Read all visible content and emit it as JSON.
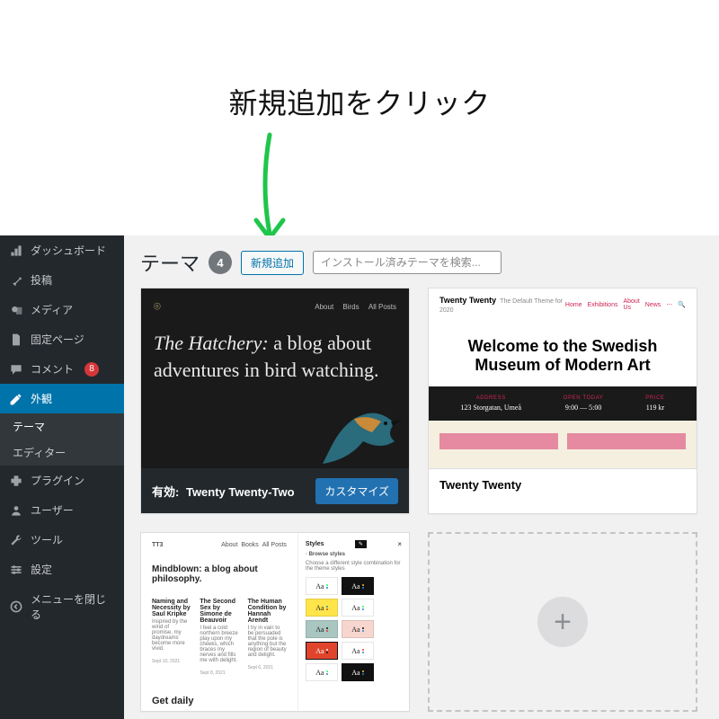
{
  "annotation": {
    "text": "新規追加をクリック"
  },
  "sidebar": {
    "items": [
      {
        "label": "ダッシュボード",
        "icon": "dashboard-icon"
      },
      {
        "label": "投稿",
        "icon": "pin-icon"
      },
      {
        "label": "メディア",
        "icon": "media-icon"
      },
      {
        "label": "固定ページ",
        "icon": "page-icon"
      },
      {
        "label": "コメント",
        "icon": "comment-icon",
        "badge": "8"
      },
      {
        "label": "外観",
        "icon": "appearance-icon",
        "current": true
      },
      {
        "label": "プラグイン",
        "icon": "plugin-icon"
      },
      {
        "label": "ユーザー",
        "icon": "user-icon"
      },
      {
        "label": "ツール",
        "icon": "tools-icon"
      },
      {
        "label": "設定",
        "icon": "settings-icon"
      },
      {
        "label": "メニューを閉じる",
        "icon": "collapse-icon"
      }
    ],
    "submenu": [
      {
        "label": "テーマ",
        "active": true
      },
      {
        "label": "エディター"
      }
    ]
  },
  "header": {
    "title": "テーマ",
    "count": "4",
    "add_new": "新規追加",
    "search_placeholder": "インストール済みテーマを検索..."
  },
  "themes": {
    "twenty_two": {
      "active_label": "有効:",
      "name": "Twenty Twenty-Two",
      "customize": "カスタマイズ",
      "nav": [
        "About",
        "Birds",
        "All Posts"
      ],
      "headline_italic": "The Hatchery:",
      "headline_rest": " a blog about adventures in bird watching."
    },
    "twenty": {
      "name": "Twenty Twenty",
      "brand": "Twenty Twenty",
      "tagline": "The Default Theme for 2020",
      "nav": [
        "Home",
        "Exhibitions",
        "About Us",
        "News"
      ],
      "hero_l1": "Welcome to the Swedish",
      "hero_l2": "Museum of Modern Art",
      "info": [
        {
          "label": "ADDRESS",
          "value": "123 Storgatan, Umeå"
        },
        {
          "label": "OPEN TODAY",
          "value": "9:00 — 5:00"
        },
        {
          "label": "PRICE",
          "value": "119 kr"
        }
      ]
    },
    "twenty_three": {
      "brand": "TT3",
      "nav": [
        "About",
        "Books",
        "All Posts"
      ],
      "headline": "Mindblown: a blog about philosophy.",
      "posts": [
        {
          "title": "Naming and Necessity by Saul Kripke",
          "excerpt": "Inspired by the wind of promise, my daydreams become more vivid.",
          "date": "Sept 10, 2021"
        },
        {
          "title": "The Second Sex by Simone de Beauvoir",
          "excerpt": "I feel a cold northern breeze play upon my cheeks, which braces my nerves and fills me with delight.",
          "date": "Sept 8, 2021"
        },
        {
          "title": "The Human Condition by Hannah Arendt",
          "excerpt": "I try in vain to be persuaded that the pole is anything but the region of beauty and delight.",
          "date": "Sept 6, 2021"
        }
      ],
      "footer": "Get daily",
      "styles_label": "Styles",
      "browse_label": "Browse styles",
      "browse_sub": "Choose a different style combination for the theme styles",
      "swatch_text": "Aa"
    }
  }
}
